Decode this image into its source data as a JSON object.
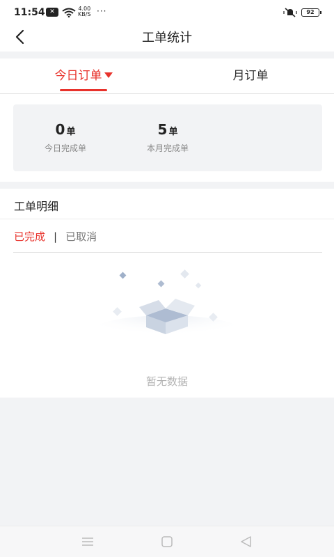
{
  "status_bar": {
    "time": "11:54",
    "speed_value": "4.00",
    "speed_unit": "KB/S",
    "more": "···",
    "battery": "92",
    "icons": [
      "message-icon",
      "wifi-icon",
      "bell-off-icon",
      "battery-icon"
    ]
  },
  "header": {
    "title": "工单统计",
    "back_icon": "back-arrow-icon"
  },
  "tabs": {
    "today": "今日订单",
    "month": "月订单",
    "active": "today"
  },
  "stats": {
    "today": {
      "value": "0",
      "unit": "单",
      "label": "今日完成单"
    },
    "month": {
      "value": "5",
      "unit": "单",
      "label": "本月完成单"
    }
  },
  "detail": {
    "title": "工单明细",
    "filter_done": "已完成",
    "filter_sep": "|",
    "filter_cancel": "已取消",
    "empty_text": "暂无数据"
  },
  "navbar": {
    "icons": [
      "menu-icon",
      "home-square-icon",
      "back-triangle-icon"
    ]
  },
  "colors": {
    "accent": "#e8322b",
    "background": "#f2f3f5",
    "muted": "#b3b3b3"
  }
}
